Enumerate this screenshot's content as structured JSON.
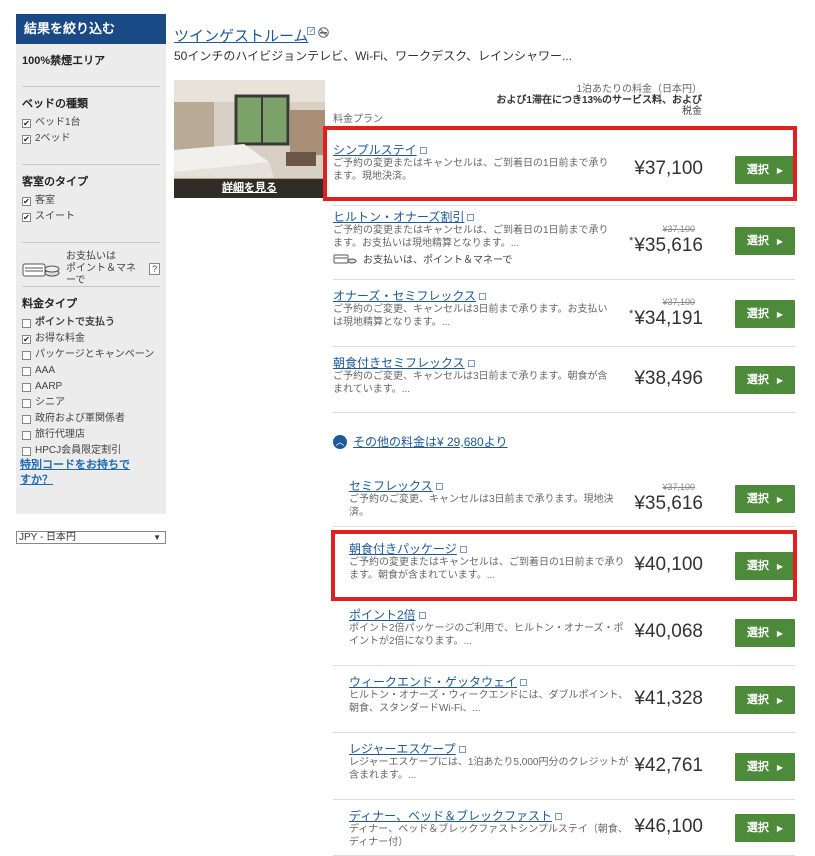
{
  "sidebar": {
    "title": "結果を絞り込む",
    "nonsmoking": "100%禁煙エリア",
    "bed_title": "ベッドの種類",
    "beds": [
      {
        "label": "ベッド1台",
        "checked": true
      },
      {
        "label": "2ベッド",
        "checked": true
      }
    ],
    "room_title": "客室のタイプ",
    "rooms": [
      {
        "label": "客室",
        "checked": true
      },
      {
        "label": "スイート",
        "checked": true
      }
    ],
    "pay_text_1": "お支払いは",
    "pay_text_2": "ポイント＆マネーで",
    "qmark": "?",
    "rate_title": "料金タイプ",
    "rates": [
      {
        "label": "ポイントで支払う",
        "checked": false,
        "bold": true
      },
      {
        "label": "お得な料金",
        "checked": true,
        "bold": false
      },
      {
        "label": "パッケージとキャンペーン",
        "checked": false,
        "bold": false
      },
      {
        "label": "AAA",
        "checked": false,
        "bold": false
      },
      {
        "label": "AARP",
        "checked": false,
        "bold": false
      },
      {
        "label": "シニア",
        "checked": false,
        "bold": false
      },
      {
        "label": "政府および軍関係者",
        "checked": false,
        "bold": false
      },
      {
        "label": "旅行代理店",
        "checked": false,
        "bold": false
      },
      {
        "label": "HPCJ会員限定割引",
        "checked": false,
        "bold": false
      }
    ],
    "special_code": "特別コードをお持ちですか？"
  },
  "currency": {
    "selected": "JPY - 日本円"
  },
  "room": {
    "title": "ツインゲストルーム",
    "description": "50インチのハイビジョンテレビ、Wi-Fi、ワークデスク、レインシャワー...",
    "photo_caption": "詳細を見る"
  },
  "table": {
    "price_header_1": "1泊あたりの料金（日本円）",
    "price_header_2": "および1滞在につき13%のサービス料、および",
    "price_header_3": "税金",
    "plan_header": "料金プラン"
  },
  "select_label": "選択",
  "more_rates": "その他の料金は¥ 29,680より",
  "pay_with_points": "お支払いは、ポイント＆マネーで",
  "rates": [
    {
      "name": "シンプルステイ",
      "desc": "ご予約の変更またはキャンセルは、ご到着日の1日前まで承ります。現地決済。",
      "price": "¥37,100",
      "strike": "",
      "star": false,
      "payline": false
    },
    {
      "name": "ヒルトン・オナーズ割引",
      "desc": "ご予約の変更またはキャンセルは、ご到着日の1日前まで承ります。お支払いは現地精算となります。...",
      "price": "¥35,616",
      "strike": "¥37,100",
      "star": true,
      "payline": true
    },
    {
      "name": "オナーズ・セミフレックス",
      "desc": "ご予約のご変更、キャンセルは3日前まで承ります。お支払いは現地精算となります。...",
      "price": "¥34,191",
      "strike": "¥37,100",
      "star": true,
      "payline": false
    },
    {
      "name": "朝食付きセミフレックス",
      "desc": "ご予約のご変更、キャンセルは3日前まで承ります。朝食が含まれています。...",
      "price": "¥38,496",
      "strike": "",
      "star": false,
      "payline": false
    }
  ],
  "more_list": [
    {
      "name": "セミフレックス",
      "desc": "ご予約のご変更、キャンセルは3日前まで承ります。現地決済。",
      "price": "¥35,616",
      "strike": "¥37,100",
      "star": false
    },
    {
      "name": "朝食付きパッケージ",
      "desc": "ご予約の変更またはキャンセルは、ご到着日の1日前まで承ります。朝食が含まれています。...",
      "price": "¥40,100",
      "strike": "",
      "star": false
    },
    {
      "name": "ポイント2倍",
      "desc": "ポイント2倍パッケージのご利用で、ヒルトン・オナーズ・ポイントが2倍になります。...",
      "price": "¥40,068",
      "strike": "",
      "star": false
    },
    {
      "name": "ウィークエンド・ゲッタウェイ",
      "desc": "ヒルトン・オナーズ・ウィークエンドには、ダブルポイント、朝食、スタンダードWi-Fi、...",
      "price": "¥41,328",
      "strike": "",
      "star": false
    },
    {
      "name": "レジャーエスケープ",
      "desc": "レジャーエスケープには、1泊あたり5,000円分のクレジットが含まれます。...",
      "price": "¥42,761",
      "strike": "",
      "star": false
    },
    {
      "name": "ディナー、ベッド＆ブレックファスト",
      "desc": "ディナー、ベッド＆ブレックファストシンプルステイ（朝食、ディナー付）",
      "price": "¥46,100",
      "strike": "",
      "star": false
    }
  ],
  "colors": {
    "sidebar_header": "#1a4a86",
    "select_button": "#4d8b3b",
    "highlight": "#e02020",
    "link": "#1e5a96"
  }
}
